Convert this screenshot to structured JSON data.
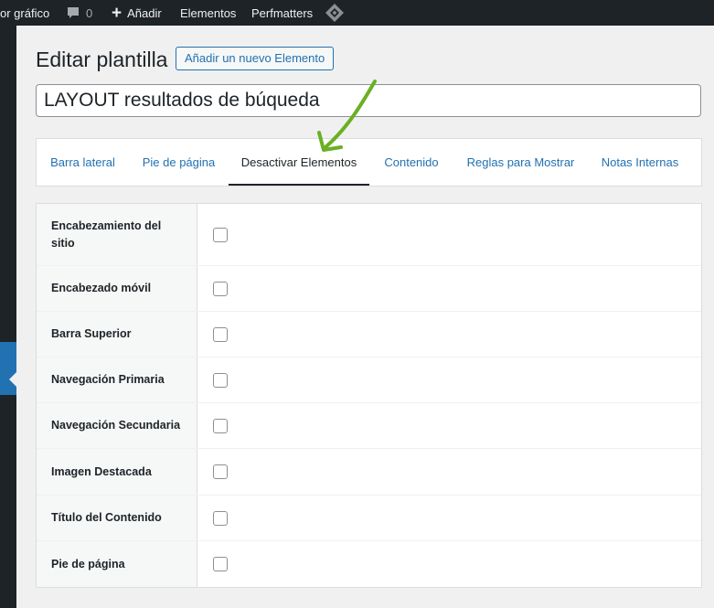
{
  "adminbar": {
    "editor_label": "or gráfico",
    "comments_count": "0",
    "new_label": "Añadir",
    "elements_label": "Elementos",
    "perfmatters_label": "Perfmatters"
  },
  "page": {
    "title": "Editar plantilla",
    "add_new_label": "Añadir un nuevo Elemento",
    "template_title": "LAYOUT resultados de búqueda"
  },
  "tabs": [
    {
      "label": "Barra lateral",
      "active": false
    },
    {
      "label": "Pie de página",
      "active": false
    },
    {
      "label": "Desactivar Elementos",
      "active": true
    },
    {
      "label": "Contenido",
      "active": false
    },
    {
      "label": "Reglas para Mostrar",
      "active": false
    },
    {
      "label": "Notas Internas",
      "active": false
    }
  ],
  "rows": [
    {
      "label": "Encabezamiento del sitio",
      "checked": false
    },
    {
      "label": "Encabezado móvil",
      "checked": false
    },
    {
      "label": "Barra Superior",
      "checked": false
    },
    {
      "label": "Navegación Primaria",
      "checked": false
    },
    {
      "label": "Navegación Secundaria",
      "checked": false
    },
    {
      "label": "Imagen Destacada",
      "checked": false
    },
    {
      "label": "Título del Contenido",
      "checked": false
    },
    {
      "label": "Pie de página",
      "checked": false
    }
  ],
  "colors": {
    "adminbar_bg": "#1d2327",
    "link": "#2271b1",
    "annotation_arrow": "#6ab023"
  }
}
